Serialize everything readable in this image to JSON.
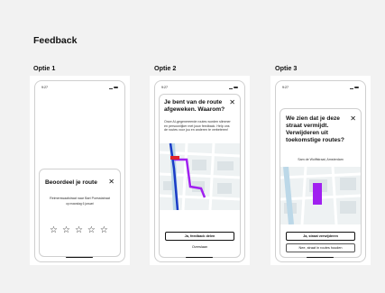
{
  "page": {
    "title": "Feedback"
  },
  "options": [
    {
      "label": "Optie 1",
      "status_time": "9:27",
      "sheet": {
        "title": "Beoordeel je route",
        "route": "Reimerswaalstraat naar Bart Poesstatraat",
        "date": "op maandag 6 januari",
        "stars": [
          "☆",
          "☆",
          "☆",
          "☆",
          "☆"
        ]
      }
    },
    {
      "label": "Optie 2",
      "status_time": "9:27",
      "sheet": {
        "title": "Je bent van de route afgeweken. Waarom?",
        "body": "Onze AI-gegenereerde routes worden slimmer en persoonlijker met jouw feedback. Help ons de routes voor jou en anderen te verbeteren!",
        "primary_button": "Ja, feedback delen",
        "secondary_button": "Overslaan"
      }
    },
    {
      "label": "Optie 3",
      "status_time": "9:27",
      "sheet": {
        "title": "We zien dat je deze straat vermijdt. Verwijderen uit toekomstige routes?",
        "street": "Sam de Wolffstraat, Amsterdam",
        "primary_button": "Ja, straat verwijderen",
        "secondary_button": "Nee, straat in routes houden"
      }
    }
  ],
  "icons": {
    "close": "close-icon",
    "star": "star-outline-icon"
  },
  "colors": {
    "route_purple": "#a020f0",
    "route_blue": "#1a3cc7",
    "marker_red": "#e0242a"
  }
}
